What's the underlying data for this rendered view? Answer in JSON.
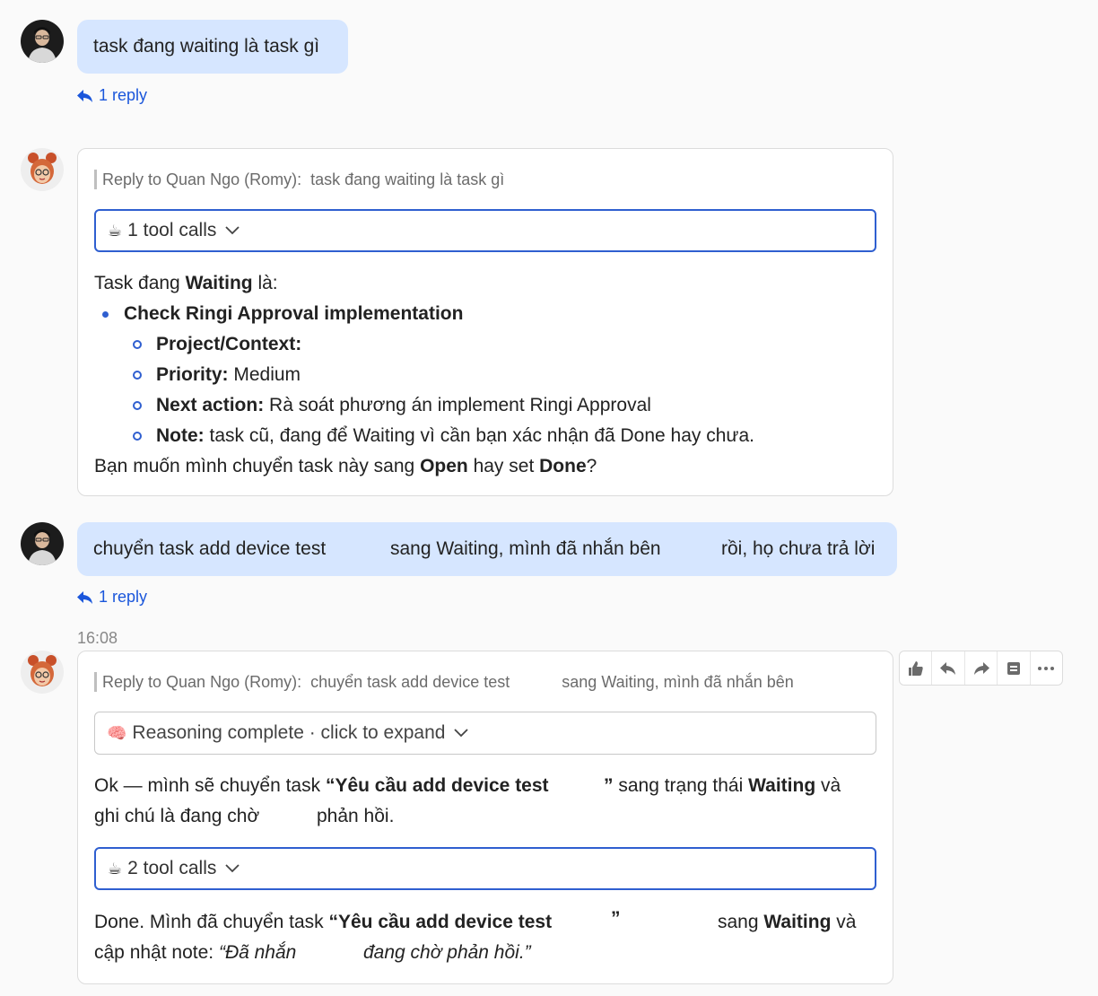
{
  "messages": {
    "m1": {
      "text": "task đang waiting là task gì",
      "reply_count": "1 reply"
    },
    "a1": {
      "quote_prefix": "Reply to Quan Ngo (Romy):",
      "quote_text": "task đang waiting là task gì",
      "tool_calls": "1 tool calls",
      "intro_pre": "Task đang ",
      "intro_bold": "Waiting",
      "intro_post": " là:",
      "item_title": "Check Ringi Approval implementation",
      "sub": [
        {
          "label": "Project/Context:",
          "value": ""
        },
        {
          "label": "Priority:",
          "value": " Medium"
        },
        {
          "label": "Next action:",
          "value": " Rà soát phương án implement Ringi Approval"
        },
        {
          "label": "Note:",
          "value": " task cũ, đang để Waiting vì cần bạn xác nhận đã Done hay chưa."
        }
      ],
      "closing_pre": "Bạn muốn mình chuyển task này sang ",
      "closing_b1": "Open",
      "closing_mid": " hay set ",
      "closing_b2": "Done",
      "closing_post": "?"
    },
    "m2": {
      "part1": "chuyển task add device test",
      "part2": "sang Waiting, mình đã nhắn bên",
      "part3": "rồi, họ chưa trả lời",
      "reply_count": "1 reply"
    },
    "timestamp": "16:08",
    "a2": {
      "quote_prefix": "Reply to Quan Ngo (Romy):",
      "quote_part1": "chuyển task add device test",
      "quote_part2": "sang Waiting, mình đã nhắn bên",
      "reasoning": "Reasoning complete · click to expand",
      "p1_pre": "Ok — mình sẽ chuyển task ",
      "p1_bold": "“Yêu cầu add device test",
      "p1_close": "”",
      "p1_mid": " sang trạng thái ",
      "p1_bold2": "Waiting",
      "p1_post": " và",
      "p1_line2_a": "ghi chú là đang chờ",
      "p1_line2_b": "phản hồi.",
      "tool_calls": "2 tool calls",
      "p2_pre": "Done. Mình đã chuyển task ",
      "p2_bold": "“Yêu cầu add device test",
      "p2_close": "”",
      "p2_mid": "sang ",
      "p2_bold2": "Waiting",
      "p2_post": " và",
      "p2_line2_a": "cập nhật note: ",
      "p2_line2_i1": "“Đã nhắn",
      "p2_line2_i2": "đang chờ phản hồi.”"
    }
  },
  "icons": [
    "reply-arrow-icon",
    "coffee-icon",
    "brain-icon",
    "chevron-down-icon",
    "thumbs-up-icon",
    "reply-icon",
    "forward-icon",
    "archive-icon",
    "more-icon"
  ],
  "colors": {
    "accent": "#2f5fd0",
    "link": "#1a56db",
    "user_bubble": "#d6e6ff"
  }
}
